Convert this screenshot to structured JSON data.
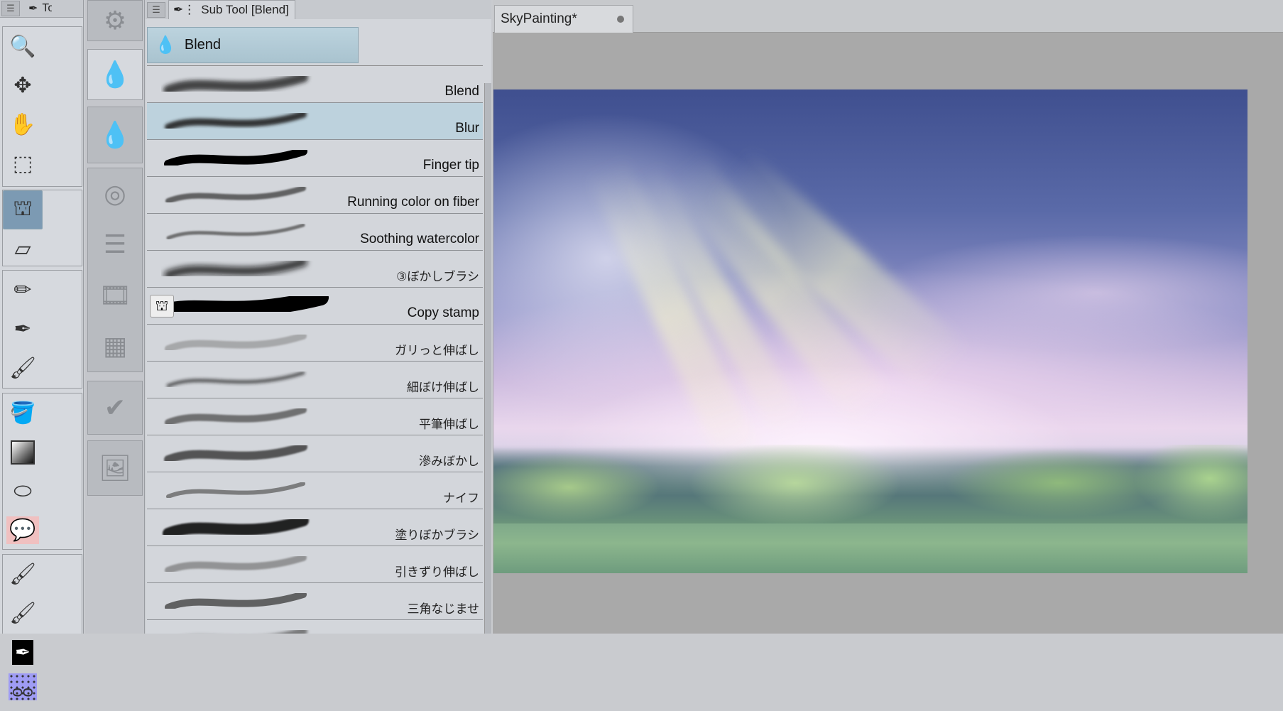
{
  "tool_panel": {
    "title": "Tool",
    "tools": [
      [
        "zoom-icon",
        "move-icon"
      ],
      [
        "hand-icon",
        "object-icon"
      ],
      [
        "rectangle-select-icon",
        "auto-select-icon"
      ],
      [
        "eyedropper-icon"
      ],
      [
        "airbrush-icon",
        "eraser-icon"
      ],
      [
        "decoration-icon"
      ],
      [
        "pencil-icon",
        "pen-icon"
      ],
      [
        "brush-icon",
        "decoration2-icon"
      ],
      [
        "blend-icon"
      ],
      [
        "fill-icon",
        "gradient-icon"
      ],
      [
        "figure-icon",
        "balloon-icon"
      ],
      [
        "text-icon",
        "ruler-icon"
      ],
      [
        "correct-line-icon",
        "tone-icon"
      ],
      [
        "watercolor-brush-icon",
        "oil-brush-icon"
      ],
      [
        "ink-pen-icon",
        "pattern-icon"
      ]
    ]
  },
  "sub_tool_panel": {
    "title": "Sub Tool [Blend]",
    "group": "Blend",
    "items": [
      {
        "label": "Blend",
        "selected": false
      },
      {
        "label": "Blur",
        "selected": true
      },
      {
        "label": "Finger tip",
        "selected": false
      },
      {
        "label": "Running color on fiber",
        "selected": false
      },
      {
        "label": "Soothing watercolor",
        "selected": false
      },
      {
        "label": "③ぼかしブラシ",
        "selected": false
      },
      {
        "label": "Copy stamp",
        "selected": false
      },
      {
        "label": "ガリっと伸ばし",
        "selected": false
      },
      {
        "label": "細ぼけ伸ばし",
        "selected": false
      },
      {
        "label": "平筆伸ばし",
        "selected": false
      },
      {
        "label": "滲みぼかし",
        "selected": false
      },
      {
        "label": "ナイフ",
        "selected": false
      },
      {
        "label": "塗りぼかブラシ",
        "selected": false
      },
      {
        "label": "引きずり伸ばし",
        "selected": false
      },
      {
        "label": "三角なじませ",
        "selected": false
      },
      {
        "label": "",
        "selected": false
      }
    ]
  },
  "canvas": {
    "tab_title": "SkyPainting*"
  }
}
